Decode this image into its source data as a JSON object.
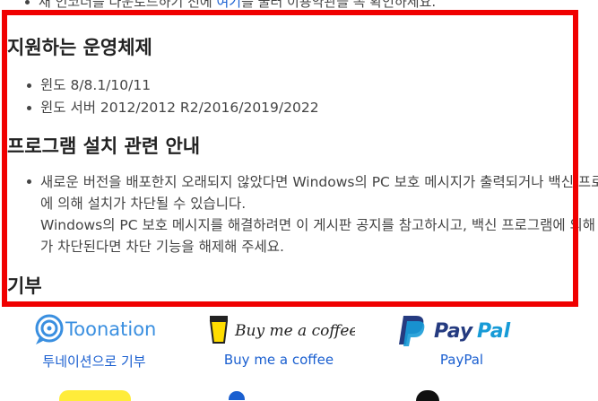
{
  "top_partial": {
    "prefix": "새 인코더를 다운로드하기 전에 ",
    "link": "여기",
    "suffix": "를 눌러 이용약관을 꼭 확인하세요."
  },
  "sections": {
    "os": {
      "title": "지원하는 운영체제",
      "items": [
        "윈도 8/8.1/10/11",
        "윈도 서버 2012/2012 R2/2016/2019/2022"
      ]
    },
    "install": {
      "title": "프로그램 설치 관련 안내",
      "lines": [
        "새로운 버전을 배포한지 오래되지 않았다면 Windows의 PC 보호 메시지가 출력되거나 백신 프로그램",
        "에 의해 설치가 차단될 수 있습니다.",
        "Windows의 PC 보호 메시지를 해결하려면 이 게시판 공지를 참고하시고, 백신 프로그램에 의해 설치",
        "가 차단된다면 차단 기능을 해제해 주세요."
      ]
    },
    "donate": {
      "title": "기부"
    }
  },
  "donations": [
    {
      "logo_text": "Toonation",
      "label": "투네이션으로 기부",
      "icon": "toonation-icon",
      "color": "#3a8fe0"
    },
    {
      "logo_text": "Buy me a coffee",
      "label": "Buy me a coffee",
      "icon": "coffee-cup-icon",
      "color": "#222222"
    },
    {
      "logo_text": "PayPal",
      "label": "PayPal",
      "icon": "paypal-icon",
      "color": "#253b80"
    }
  ],
  "colors": {
    "highlight": "#f00000",
    "link": "#1a5fd0",
    "paypal_light": "#179bd7"
  }
}
